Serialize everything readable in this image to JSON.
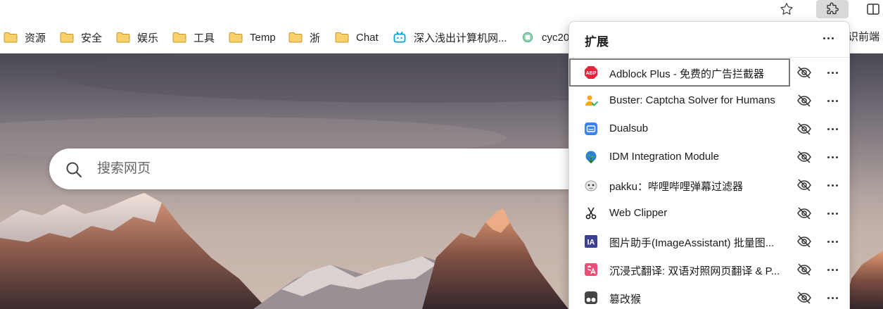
{
  "favorites": [
    {
      "label": "资源",
      "icon": "folder-icon"
    },
    {
      "label": "安全",
      "icon": "folder-icon"
    },
    {
      "label": "娱乐",
      "icon": "folder-icon"
    },
    {
      "label": "工具",
      "icon": "folder-icon"
    },
    {
      "label": "Temp",
      "icon": "folder-icon"
    },
    {
      "label": "浙",
      "icon": "folder-icon"
    },
    {
      "label": "Chat",
      "icon": "folder-icon"
    },
    {
      "label": "深入浅出计算机网...",
      "icon": "bilibili-icon"
    },
    {
      "label": "cyc20",
      "icon": "site-icon"
    }
  ],
  "favorites_overflow_text": "识前端",
  "search": {
    "placeholder": "搜索网页"
  },
  "extensions_panel": {
    "title": "扩展",
    "items": [
      {
        "name": "Adblock Plus - 免费的广告拦截器",
        "icon": "abp-icon"
      },
      {
        "name": "Buster: Captcha Solver for Humans",
        "icon": "buster-icon"
      },
      {
        "name": "Dualsub",
        "icon": "dualsub-icon"
      },
      {
        "name": "IDM Integration Module",
        "icon": "idm-icon"
      },
      {
        "name": "pakku：哔哩哔哩弹幕过滤器",
        "icon": "pakku-icon"
      },
      {
        "name": "Web Clipper",
        "icon": "scissors-icon"
      },
      {
        "name": "图片助手(ImageAssistant) 批量图...",
        "icon": "imageassistant-icon"
      },
      {
        "name": "沉浸式翻译: 双语对照网页翻译 & P...",
        "icon": "immersive-translate-icon"
      },
      {
        "name": "篡改猴",
        "icon": "tampermonkey-icon"
      }
    ]
  },
  "colors": {
    "folder": "#f5c440",
    "abp": "#e8243c",
    "dualsub": "#3b82f6",
    "imageassistant": "#3a3f8f",
    "immersive": "#e94e77"
  }
}
